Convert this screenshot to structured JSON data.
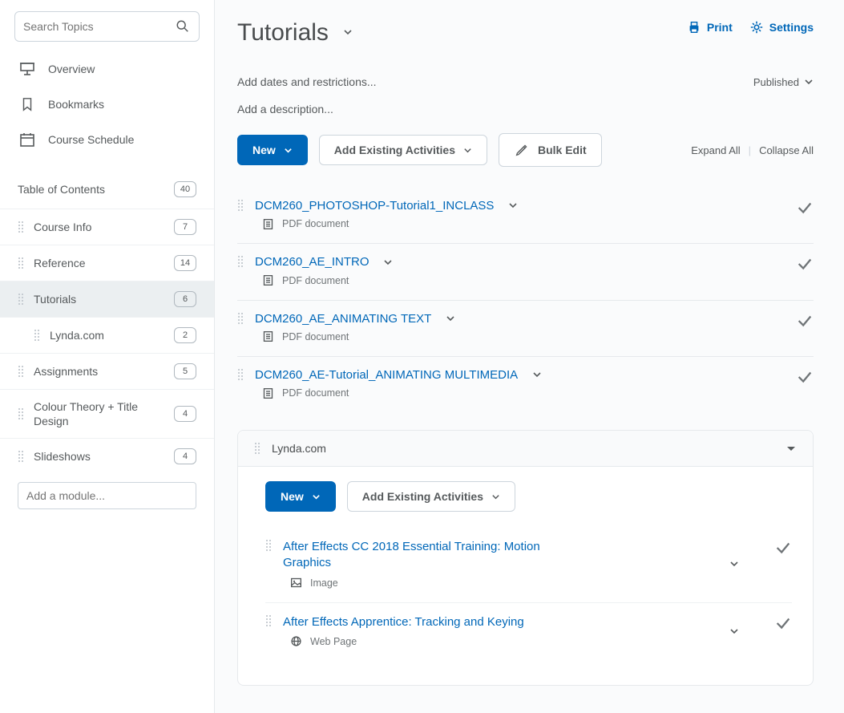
{
  "search": {
    "placeholder": "Search Topics"
  },
  "nav": {
    "overview": "Overview",
    "bookmarks": "Bookmarks",
    "schedule": "Course Schedule"
  },
  "toc": {
    "header": "Table of Contents",
    "total_badge": "40",
    "items": [
      {
        "label": "Course Info",
        "badge": "7",
        "nested": false,
        "selected": false,
        "slug": "course-info"
      },
      {
        "label": "Reference",
        "badge": "14",
        "nested": false,
        "selected": false,
        "slug": "reference"
      },
      {
        "label": "Tutorials",
        "badge": "6",
        "nested": false,
        "selected": true,
        "slug": "tutorials"
      },
      {
        "label": "Lynda.com",
        "badge": "2",
        "nested": true,
        "selected": false,
        "slug": "lynda"
      },
      {
        "label": "Assignments",
        "badge": "5",
        "nested": false,
        "selected": false,
        "slug": "assignments"
      },
      {
        "label": "Colour Theory + Title Design",
        "badge": "4",
        "nested": false,
        "selected": false,
        "slug": "colour-theory"
      },
      {
        "label": "Slideshows",
        "badge": "4",
        "nested": false,
        "selected": false,
        "slug": "slideshows"
      }
    ],
    "add_module_placeholder": "Add a module..."
  },
  "page": {
    "title": "Tutorials",
    "print": "Print",
    "settings": "Settings",
    "dates": "Add dates and restrictions...",
    "published": "Published",
    "description": "Add a description..."
  },
  "toolbar": {
    "new": "New",
    "add_existing": "Add Existing Activities",
    "bulk_edit": "Bulk Edit",
    "expand": "Expand All",
    "collapse": "Collapse All"
  },
  "items": [
    {
      "title": "DCM260_PHOTOSHOP-Tutorial1_INCLASS",
      "type": "PDF document",
      "icon": "document"
    },
    {
      "title": "DCM260_AE_INTRO",
      "type": "PDF document",
      "icon": "document"
    },
    {
      "title": "DCM260_AE_ANIMATING TEXT",
      "type": "PDF document",
      "icon": "document"
    },
    {
      "title": "DCM260_AE-Tutorial_ANIMATING MULTIMEDIA",
      "type": "PDF document",
      "icon": "document"
    }
  ],
  "submodule": {
    "title": "Lynda.com",
    "toolbar": {
      "new": "New",
      "add_existing": "Add Existing Activities"
    },
    "items": [
      {
        "title": "After Effects CC 2018 Essential Training: Motion Graphics",
        "type": "Image",
        "icon": "image"
      },
      {
        "title": "After Effects Apprentice: Tracking and Keying",
        "type": "Web Page",
        "icon": "web"
      }
    ]
  }
}
